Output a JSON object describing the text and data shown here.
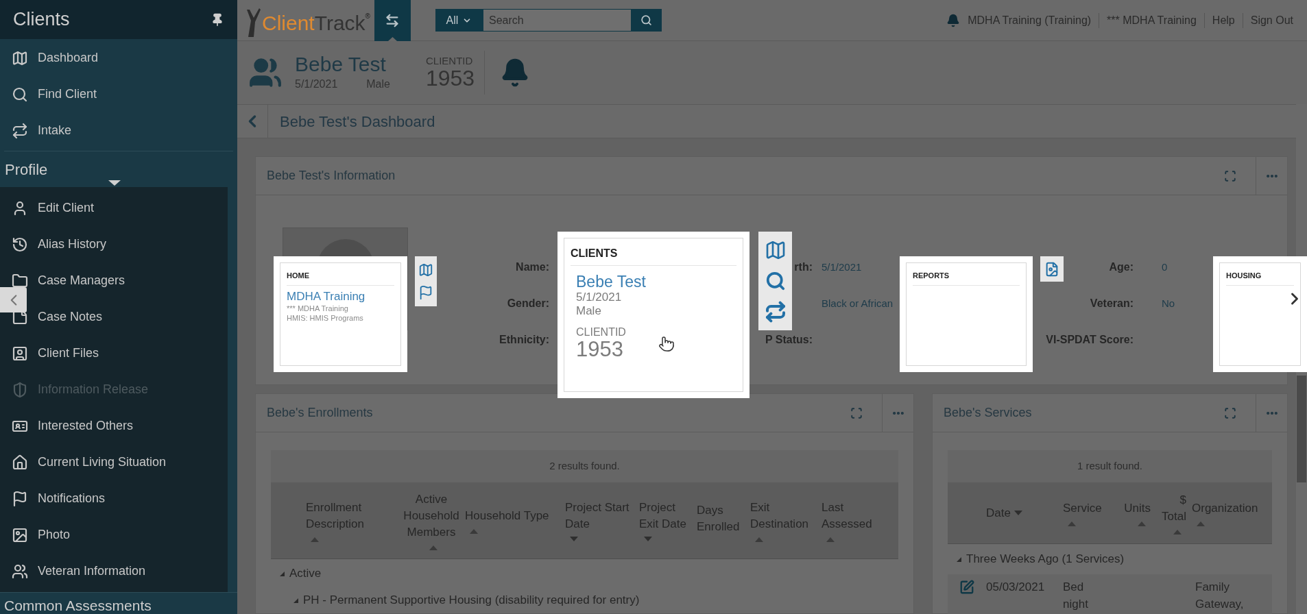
{
  "sidebar": {
    "title": "Clients",
    "items": [
      {
        "label": "Dashboard",
        "disabled": false
      },
      {
        "label": "Find Client",
        "disabled": false
      },
      {
        "label": "Intake",
        "disabled": false
      }
    ],
    "profile": {
      "title": "Profile",
      "expanded": true,
      "items": [
        {
          "label": "Edit Client",
          "disabled": false
        },
        {
          "label": "Alias History",
          "disabled": false
        },
        {
          "label": "Case Managers",
          "disabled": false
        },
        {
          "label": "Case Notes",
          "disabled": false
        },
        {
          "label": "Client Files",
          "disabled": false
        },
        {
          "label": "Information Release",
          "disabled": true
        },
        {
          "label": "Interested Others",
          "disabled": false
        },
        {
          "label": "Current Living Situation",
          "disabled": false
        },
        {
          "label": "Notifications",
          "disabled": false
        },
        {
          "label": "Photo",
          "disabled": false
        },
        {
          "label": "Veteran Information",
          "disabled": false
        }
      ]
    },
    "next_section": "Common Assessments"
  },
  "topbar": {
    "logo_primary": "Client",
    "logo_secondary": "Track",
    "logo_mark": "®",
    "search_scope": "All",
    "search_placeholder": "Search",
    "links": [
      "MDHA Training (Training)",
      "*** MDHA Training",
      "Help",
      "Sign Out"
    ]
  },
  "client": {
    "name": "Bebe Test",
    "dob": "5/1/2021",
    "gender": "Male",
    "id_label": "CLIENTID",
    "id": "1953"
  },
  "breadcrumb": {
    "title": "Bebe Test's Dashboard"
  },
  "info": {
    "title": "Bebe Test's Information",
    "rows": [
      [
        {
          "label": "Name:"
        },
        {
          "label": "rth:",
          "value": "5/1/2021"
        },
        {
          "label": "Age:",
          "value": "0"
        }
      ],
      [
        {
          "label": "Gender:"
        },
        {
          "value": "Black or African"
        },
        {
          "label": "Veteran:",
          "value": "No"
        }
      ],
      [
        {
          "label": "Ethnicity:"
        },
        {
          "label": "P Status:"
        },
        {
          "label": "VI-SPDAT Score:"
        }
      ]
    ]
  },
  "enrollments": {
    "title": "Bebe's Enrollments",
    "results": "2 results found.",
    "columns": [
      {
        "label": "Enrollment Description",
        "sort_ascending": true
      },
      {
        "label": "Active Household Members",
        "sort_ascending": true
      },
      {
        "label": "Household Type",
        "sort_ascending": true
      },
      {
        "label": "Project Start Date",
        "sort_ascending": false
      },
      {
        "label": "Project Exit Date",
        "sort_ascending": false
      },
      {
        "label": "Days Enrolled"
      },
      {
        "label": "Exit Destination",
        "sort_ascending": true
      },
      {
        "label": "Last Assessed",
        "sort_ascending": true
      }
    ],
    "groups": [
      {
        "label": "Active",
        "expanded": true,
        "children": [
          {
            "label": "PH - Permanent Supportive Housing (disability required for entry)",
            "expanded": true
          }
        ]
      }
    ]
  },
  "services": {
    "title": "Bebe's Services",
    "results": "1 result found.",
    "columns": [
      {
        "label": "Date",
        "sort_ascending": false
      },
      {
        "label": "Service",
        "sort_ascending": true
      },
      {
        "label": "Units",
        "sort_ascending": true
      },
      {
        "label": "$ Total",
        "sort_ascending": true
      },
      {
        "label": "Organization",
        "sort_ascending": true
      }
    ],
    "groups": [
      {
        "label": "Three Weeks Ago (1 Services)",
        "expanded": true,
        "rows": [
          {
            "date": "05/03/2021",
            "service": "Bed night",
            "organization": "Family Gateway,"
          }
        ]
      }
    ]
  },
  "tour": {
    "cards": [
      {
        "kind": "org",
        "title": "HOME",
        "link": "MDHA Training",
        "lines": [
          "*** MDHA Training",
          "HMIS: HMIS Programs"
        ]
      },
      {
        "kind": "client",
        "title": "CLIENTS",
        "name": "Bebe Test",
        "dob": "5/1/2021",
        "gender": "Male",
        "id_label": "CLIENTID",
        "id": "1953"
      },
      {
        "kind": "empty",
        "title": "REPORTS"
      },
      {
        "kind": "empty",
        "title": "HOUSING"
      }
    ]
  }
}
